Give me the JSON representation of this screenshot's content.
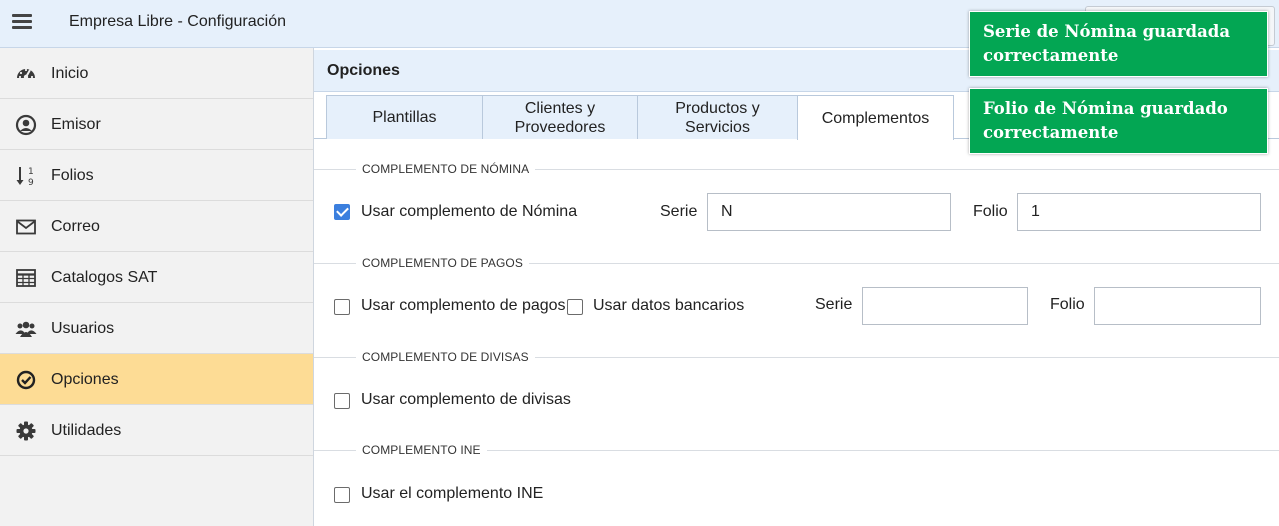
{
  "app": {
    "title": "Empresa Libre - Configuración"
  },
  "sidebar": {
    "items": [
      {
        "label": "Inicio",
        "icon": "dashboard-icon",
        "active": false
      },
      {
        "label": "Emisor",
        "icon": "user-circle-icon",
        "active": false
      },
      {
        "label": "Folios",
        "icon": "sort-numeric-icon",
        "active": false
      },
      {
        "label": "Correo",
        "icon": "envelope-icon",
        "active": false
      },
      {
        "label": "Catalogos SAT",
        "icon": "table-icon",
        "active": false
      },
      {
        "label": "Usuarios",
        "icon": "users-icon",
        "active": false
      },
      {
        "label": "Opciones",
        "icon": "check-circle-icon",
        "active": true
      },
      {
        "label": "Utilidades",
        "icon": "gear-icon",
        "active": false
      }
    ]
  },
  "section": {
    "title": "Opciones"
  },
  "tabs": [
    {
      "label": "Plantillas",
      "active": false
    },
    {
      "label": "Clientes y\nProveedores",
      "active": false
    },
    {
      "label": "Productos y\nServicios",
      "active": false
    },
    {
      "label": "Complementos",
      "active": true
    }
  ],
  "nomina": {
    "group_title": "COMPLEMENTO DE NÓMINA",
    "checkbox_label": "Usar complemento de Nómina",
    "checked": true,
    "serie_label": "Serie",
    "serie_value": "N",
    "folio_label": "Folio",
    "folio_value": "1"
  },
  "pagos": {
    "group_title": "COMPLEMENTO DE PAGOS",
    "checkbox_label": "Usar complemento de pagos",
    "checked": false,
    "bancarios_label": "Usar datos bancarios",
    "bancarios_checked": false,
    "serie_label": "Serie",
    "serie_value": "",
    "folio_label": "Folio",
    "folio_value": ""
  },
  "divisas": {
    "group_title": "COMPLEMENTO DE DIVISAS",
    "checkbox_label": "Usar complemento de divisas",
    "checked": false
  },
  "ine": {
    "group_title": "COMPLEMENTO INE",
    "checkbox_label": "Usar el complemento INE",
    "checked": false
  },
  "toasts": [
    {
      "text": "Serie de Nómina guardada correctamente"
    },
    {
      "text": "Folio de Nómina guardado correctamente"
    }
  ],
  "colors": {
    "active_item": "#fddc95",
    "header_bg": "#e6f0fb",
    "toast_bg": "#03a653",
    "checkbox_checked": "#3b7fde"
  }
}
